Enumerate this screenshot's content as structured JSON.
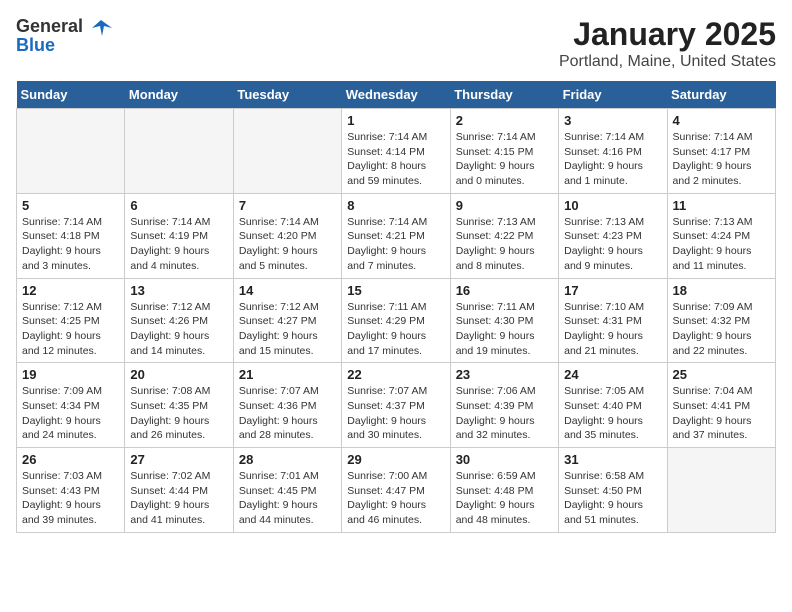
{
  "header": {
    "logo_line1": "General",
    "logo_line2": "Blue",
    "title": "January 2025",
    "subtitle": "Portland, Maine, United States"
  },
  "weekdays": [
    "Sunday",
    "Monday",
    "Tuesday",
    "Wednesday",
    "Thursday",
    "Friday",
    "Saturday"
  ],
  "weeks": [
    [
      {
        "day": "",
        "info": ""
      },
      {
        "day": "",
        "info": ""
      },
      {
        "day": "",
        "info": ""
      },
      {
        "day": "1",
        "info": "Sunrise: 7:14 AM\nSunset: 4:14 PM\nDaylight: 8 hours and 59 minutes."
      },
      {
        "day": "2",
        "info": "Sunrise: 7:14 AM\nSunset: 4:15 PM\nDaylight: 9 hours and 0 minutes."
      },
      {
        "day": "3",
        "info": "Sunrise: 7:14 AM\nSunset: 4:16 PM\nDaylight: 9 hours and 1 minute."
      },
      {
        "day": "4",
        "info": "Sunrise: 7:14 AM\nSunset: 4:17 PM\nDaylight: 9 hours and 2 minutes."
      }
    ],
    [
      {
        "day": "5",
        "info": "Sunrise: 7:14 AM\nSunset: 4:18 PM\nDaylight: 9 hours and 3 minutes."
      },
      {
        "day": "6",
        "info": "Sunrise: 7:14 AM\nSunset: 4:19 PM\nDaylight: 9 hours and 4 minutes."
      },
      {
        "day": "7",
        "info": "Sunrise: 7:14 AM\nSunset: 4:20 PM\nDaylight: 9 hours and 5 minutes."
      },
      {
        "day": "8",
        "info": "Sunrise: 7:14 AM\nSunset: 4:21 PM\nDaylight: 9 hours and 7 minutes."
      },
      {
        "day": "9",
        "info": "Sunrise: 7:13 AM\nSunset: 4:22 PM\nDaylight: 9 hours and 8 minutes."
      },
      {
        "day": "10",
        "info": "Sunrise: 7:13 AM\nSunset: 4:23 PM\nDaylight: 9 hours and 9 minutes."
      },
      {
        "day": "11",
        "info": "Sunrise: 7:13 AM\nSunset: 4:24 PM\nDaylight: 9 hours and 11 minutes."
      }
    ],
    [
      {
        "day": "12",
        "info": "Sunrise: 7:12 AM\nSunset: 4:25 PM\nDaylight: 9 hours and 12 minutes."
      },
      {
        "day": "13",
        "info": "Sunrise: 7:12 AM\nSunset: 4:26 PM\nDaylight: 9 hours and 14 minutes."
      },
      {
        "day": "14",
        "info": "Sunrise: 7:12 AM\nSunset: 4:27 PM\nDaylight: 9 hours and 15 minutes."
      },
      {
        "day": "15",
        "info": "Sunrise: 7:11 AM\nSunset: 4:29 PM\nDaylight: 9 hours and 17 minutes."
      },
      {
        "day": "16",
        "info": "Sunrise: 7:11 AM\nSunset: 4:30 PM\nDaylight: 9 hours and 19 minutes."
      },
      {
        "day": "17",
        "info": "Sunrise: 7:10 AM\nSunset: 4:31 PM\nDaylight: 9 hours and 21 minutes."
      },
      {
        "day": "18",
        "info": "Sunrise: 7:09 AM\nSunset: 4:32 PM\nDaylight: 9 hours and 22 minutes."
      }
    ],
    [
      {
        "day": "19",
        "info": "Sunrise: 7:09 AM\nSunset: 4:34 PM\nDaylight: 9 hours and 24 minutes."
      },
      {
        "day": "20",
        "info": "Sunrise: 7:08 AM\nSunset: 4:35 PM\nDaylight: 9 hours and 26 minutes."
      },
      {
        "day": "21",
        "info": "Sunrise: 7:07 AM\nSunset: 4:36 PM\nDaylight: 9 hours and 28 minutes."
      },
      {
        "day": "22",
        "info": "Sunrise: 7:07 AM\nSunset: 4:37 PM\nDaylight: 9 hours and 30 minutes."
      },
      {
        "day": "23",
        "info": "Sunrise: 7:06 AM\nSunset: 4:39 PM\nDaylight: 9 hours and 32 minutes."
      },
      {
        "day": "24",
        "info": "Sunrise: 7:05 AM\nSunset: 4:40 PM\nDaylight: 9 hours and 35 minutes."
      },
      {
        "day": "25",
        "info": "Sunrise: 7:04 AM\nSunset: 4:41 PM\nDaylight: 9 hours and 37 minutes."
      }
    ],
    [
      {
        "day": "26",
        "info": "Sunrise: 7:03 AM\nSunset: 4:43 PM\nDaylight: 9 hours and 39 minutes."
      },
      {
        "day": "27",
        "info": "Sunrise: 7:02 AM\nSunset: 4:44 PM\nDaylight: 9 hours and 41 minutes."
      },
      {
        "day": "28",
        "info": "Sunrise: 7:01 AM\nSunset: 4:45 PM\nDaylight: 9 hours and 44 minutes."
      },
      {
        "day": "29",
        "info": "Sunrise: 7:00 AM\nSunset: 4:47 PM\nDaylight: 9 hours and 46 minutes."
      },
      {
        "day": "30",
        "info": "Sunrise: 6:59 AM\nSunset: 4:48 PM\nDaylight: 9 hours and 48 minutes."
      },
      {
        "day": "31",
        "info": "Sunrise: 6:58 AM\nSunset: 4:50 PM\nDaylight: 9 hours and 51 minutes."
      },
      {
        "day": "",
        "info": ""
      }
    ]
  ]
}
